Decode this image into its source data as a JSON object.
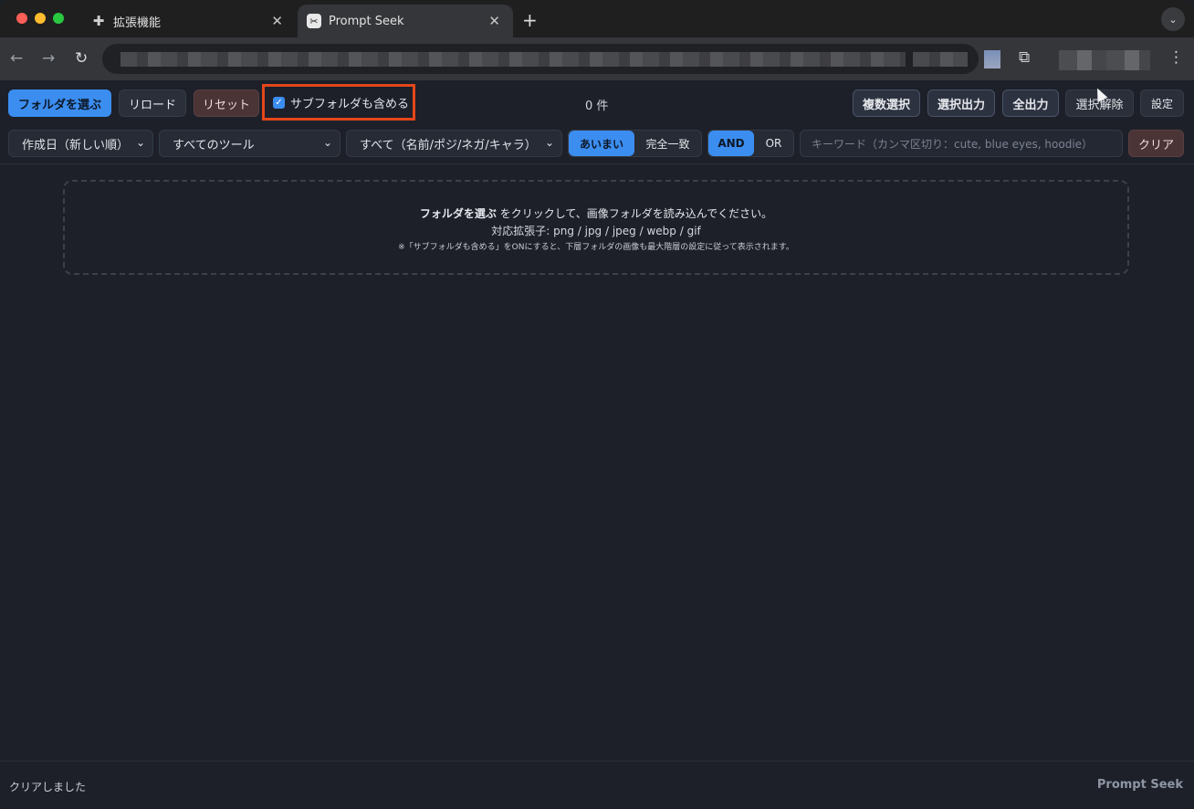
{
  "browser": {
    "tabs": [
      {
        "title": "拡張機能",
        "icon": "puzzle-icon"
      },
      {
        "title": "Prompt Seek",
        "icon": "app-favicon"
      }
    ]
  },
  "toolbar": {
    "choose_folder": "フォルダを選ぶ",
    "reload": "リロード",
    "reset": "リセット",
    "include_subfolders": "サブフォルダも含める",
    "include_subfolders_checked": true,
    "count": "0 件",
    "multi_select": "複数選択",
    "export_selected": "選択出力",
    "export_all": "全出力",
    "deselect": "選択解除",
    "settings": "設定"
  },
  "filters": {
    "sort": "作成日（新しい順）",
    "tool": "すべてのツール",
    "field": "すべて（名前/ポジ/ネガ/キャラ）",
    "match_fuzzy": "あいまい",
    "match_exact": "完全一致",
    "logic_and": "AND",
    "logic_or": "OR",
    "keyword_placeholder": "キーワード（カンマ区切り：cute, blue eyes, hoodie）",
    "clear": "クリア"
  },
  "dropzone": {
    "main_bold": "フォルダを選ぶ",
    "main_rest": " をクリックして、画像フォルダを読み込んでください。",
    "extensions": "対応拡張子: png / jpg / jpeg / webp / gif",
    "note": "※「サブフォルダも含める」をONにすると、下層フォルダの画像も最大階層の設定に従って表示されます。"
  },
  "footer": {
    "status": "クリアしました",
    "brand": "Prompt Seek"
  }
}
